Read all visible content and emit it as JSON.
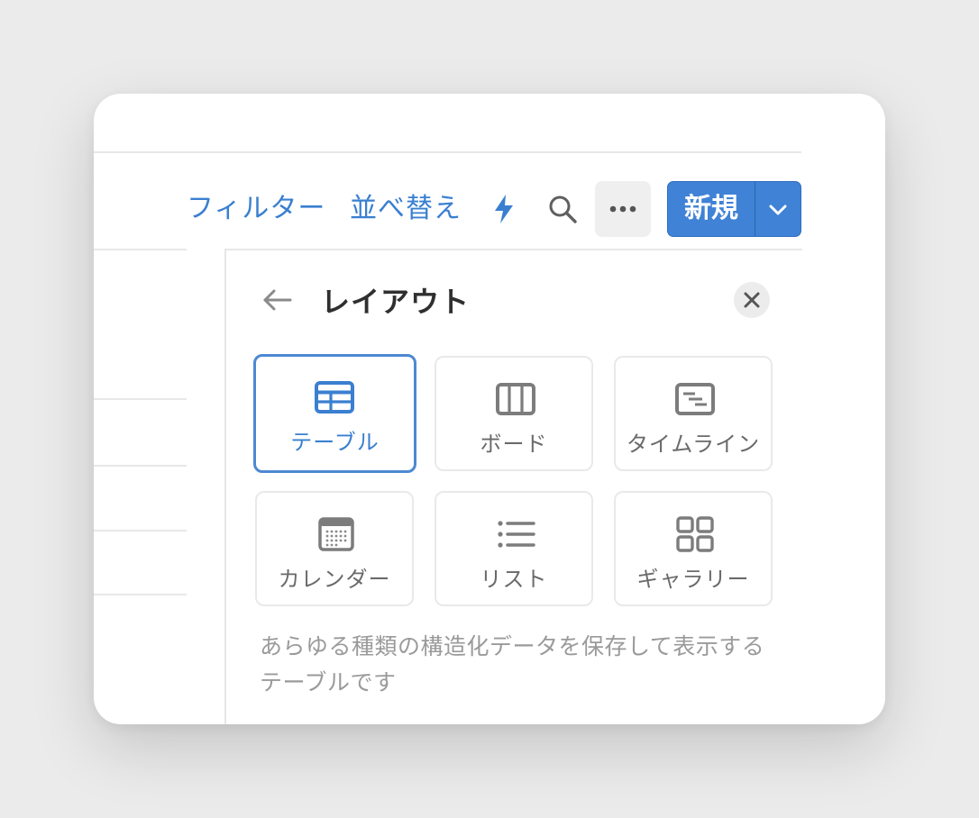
{
  "toolbar": {
    "filter_label": "フィルター",
    "sort_label": "並べ替え",
    "new_label": "新規",
    "automation_icon": "lightning-icon",
    "search_icon": "search-icon",
    "more_icon": "more-dots-icon",
    "dropdown_icon": "chevron-down-icon"
  },
  "layout_panel": {
    "title": "レイアウト",
    "back_icon": "arrow-left-icon",
    "close_icon": "close-icon",
    "options": [
      {
        "label": "テーブル",
        "icon": "table-icon",
        "selected": true
      },
      {
        "label": "ボード",
        "icon": "board-icon",
        "selected": false
      },
      {
        "label": "タイムライン",
        "icon": "timeline-icon",
        "selected": false
      },
      {
        "label": "カレンダー",
        "icon": "calendar-icon",
        "selected": false
      },
      {
        "label": "リスト",
        "icon": "list-icon",
        "selected": false
      },
      {
        "label": "ギャラリー",
        "icon": "gallery-icon",
        "selected": false
      }
    ],
    "description": "あらゆる種類の構造化データを保存して表示するテーブルです"
  },
  "colors": {
    "accent": "#3a7fd0",
    "new_button": "#3f82d6",
    "text_muted": "#6a6a6a",
    "description_text": "#9a9a9a"
  }
}
